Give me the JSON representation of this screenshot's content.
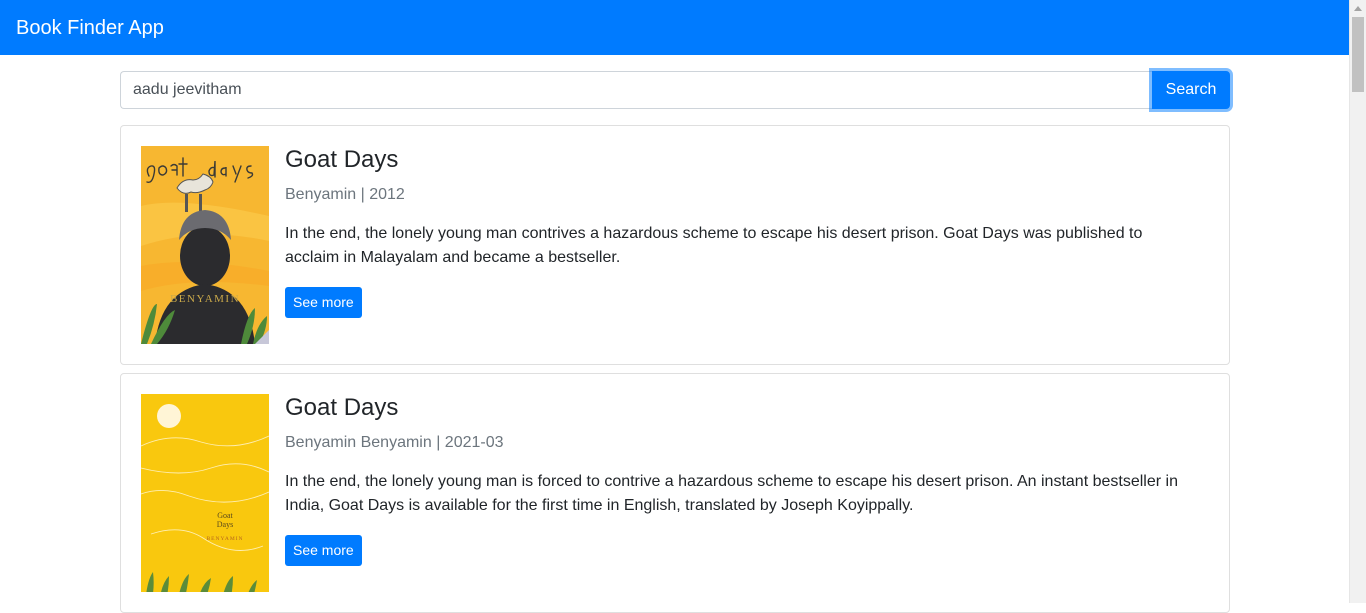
{
  "navbar": {
    "brand": "Book Finder App"
  },
  "search": {
    "value": "aadu jeevitham",
    "button_label": "Search"
  },
  "results": [
    {
      "title": "Goat Days",
      "subtitle": "Benyamin | 2012",
      "description": "In the end, the lonely young man contrives a hazardous scheme to escape his desert prison. Goat Days was published to acclaim in Malayalam and became a bestseller.",
      "button_label": "See more",
      "cover": {
        "title_text": "goat days",
        "author_text": "BENYAMIN",
        "bg_color": "#f7b731"
      }
    },
    {
      "title": "Goat Days",
      "subtitle": "Benyamin Benyamin | 2021-03",
      "description": "In the end, the lonely young man is forced to contrive a hazardous scheme to escape his desert prison. An instant bestseller in India, Goat Days is available for the first time in English, translated by Joseph Koyippally.",
      "button_label": "See more",
      "cover": {
        "title_text_1": "Goat",
        "title_text_2": "Days",
        "author_text": "BENYAMIN",
        "bg_color": "#f9c80e"
      }
    }
  ],
  "colors": {
    "primary": "#007bff",
    "muted": "#6c757d"
  }
}
